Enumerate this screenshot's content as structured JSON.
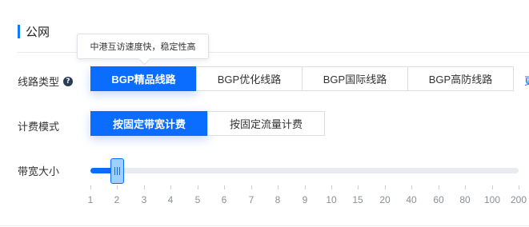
{
  "section": {
    "title": "公网"
  },
  "tooltip": {
    "text": "中港互访速度快，稳定性高"
  },
  "line_type": {
    "label": "线路类型",
    "help_icon": "question-circle-icon",
    "options": [
      "BGP精品线路",
      "BGP优化线路",
      "BGP国际线路",
      "BGP高防线路"
    ],
    "selected": "BGP精品线路",
    "more_hint": "更"
  },
  "billing": {
    "label": "计费模式",
    "options": [
      "按固定带宽计费",
      "按固定流量计费"
    ],
    "selected": "按固定带宽计费"
  },
  "bandwidth": {
    "label": "带宽大小",
    "value": 2,
    "scale": [
      "1",
      "2",
      "3",
      "4",
      "5",
      "6",
      "7",
      "8",
      "9",
      "10",
      "15",
      "20",
      "40",
      "60",
      "80",
      "100",
      "200"
    ]
  },
  "colors": {
    "accent": "#0a6dff",
    "handle": "#9fd0ff",
    "track": "#e8ebf0"
  }
}
